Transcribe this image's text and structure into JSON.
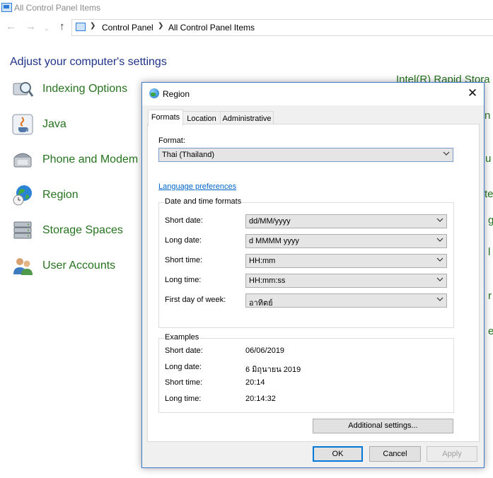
{
  "window": {
    "title": "All Control Panel Items",
    "address": {
      "crumbs": [
        "Control Panel",
        "All Control Panel Items"
      ]
    },
    "heading": "Adjust your computer's settings",
    "items": [
      {
        "label": "Indexing Options",
        "icon": "indexing-icon"
      },
      {
        "label": "Java",
        "icon": "java-icon"
      },
      {
        "label": "Phone and Modem",
        "icon": "phone-icon"
      },
      {
        "label": "Region",
        "icon": "region-globe-icon"
      },
      {
        "label": "Storage Spaces",
        "icon": "storage-icon"
      },
      {
        "label": "User Accounts",
        "icon": "users-icon"
      }
    ],
    "partial_right": [
      "Intel(R) Rapid Stora",
      "n",
      "u",
      "te",
      "g",
      "l",
      "r",
      "e"
    ]
  },
  "dialog": {
    "title": "Region",
    "tabs": [
      "Formats",
      "Location",
      "Administrative"
    ],
    "active_tab": "Formats",
    "format_label": "Format:",
    "format_value": "Thai (Thailand)",
    "language_link": "Language preferences",
    "dt_group_title": "Date and time formats",
    "formats": [
      {
        "label": "Short date:",
        "value": "dd/MM/yyyy"
      },
      {
        "label": "Long date:",
        "value": "d MMMM yyyy"
      },
      {
        "label": "Short time:",
        "value": "HH:mm"
      },
      {
        "label": "Long time:",
        "value": "HH:mm:ss"
      },
      {
        "label": "First day of week:",
        "value": "อาทิตย์"
      }
    ],
    "examples_title": "Examples",
    "examples": [
      {
        "label": "Short date:",
        "value": "06/06/2019"
      },
      {
        "label": "Long date:",
        "value": "6 มิถุนายน 2019"
      },
      {
        "label": "Short time:",
        "value": "20:14"
      },
      {
        "label": "Long time:",
        "value": "20:14:32"
      }
    ],
    "additional_button": "Additional settings...",
    "ok_button": "OK",
    "cancel_button": "Cancel",
    "apply_button": "Apply"
  },
  "colors": {
    "link_green": "#26731f",
    "heading_blue": "#1e3287",
    "link_blue": "#0066cc",
    "accent": "#0078d7"
  }
}
